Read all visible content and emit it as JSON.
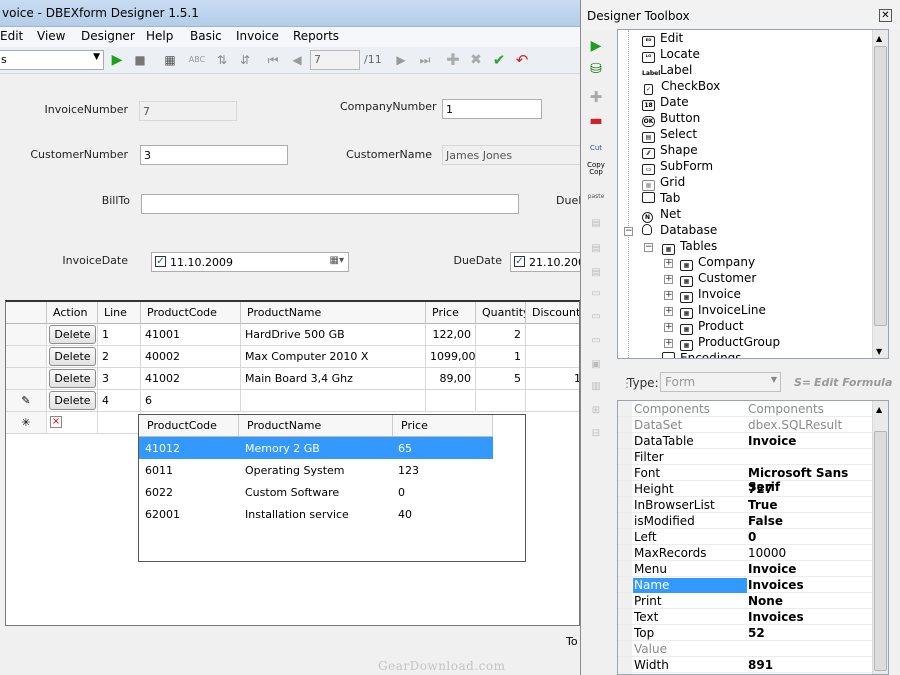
{
  "app": {
    "title": "voice - DBEXform Designer 1.5.1"
  },
  "menu": [
    "Edit",
    "View",
    "Designer",
    "Help",
    "Basic",
    "Invoice",
    "Reports"
  ],
  "toolbar": {
    "combo_value": "s",
    "record_current": "7",
    "record_total": "/11"
  },
  "form": {
    "labels": {
      "invoice_number": "InvoiceNumber",
      "company_number": "CompanyNumber",
      "customer_number": "CustomerNumber",
      "customer_name": "CustomerName",
      "bill_to": "BillTo",
      "due_partial": "DueI",
      "invoice_date": "InvoiceDate",
      "due_date": "DueDate"
    },
    "values": {
      "invoice_number": "7",
      "company_number": "1",
      "customer_number": "3",
      "customer_name": "James Jones",
      "bill_to": "",
      "invoice_date": "11.10.2009",
      "due_date": "21.10.2009"
    }
  },
  "grid": {
    "headers": [
      "Action",
      "Line",
      "ProductCode",
      "ProductName",
      "Price",
      "Quantity",
      "DiscountT"
    ],
    "delete_label": "Delete",
    "rows": [
      {
        "line": "1",
        "code": "41001",
        "name": "HardDrive 500 GB",
        "price": "122,00",
        "qty": "2",
        "disc": ""
      },
      {
        "line": "2",
        "code": "40002",
        "name": "Max Computer 2010 X",
        "price": "1099,00",
        "qty": "1",
        "disc": ""
      },
      {
        "line": "3",
        "code": "41002",
        "name": "Main Board 3,4 Ghz",
        "price": "89,00",
        "qty": "5",
        "disc": "1"
      },
      {
        "line": "4",
        "code": "6",
        "name": "",
        "price": "",
        "qty": "",
        "disc": ""
      }
    ],
    "edit_marker": "✎",
    "new_marker": "✳"
  },
  "popup": {
    "headers": [
      "ProductCode",
      "ProductName",
      "Price"
    ],
    "rows": [
      {
        "code": "41012",
        "name": "Memory 2 GB",
        "price": "65"
      },
      {
        "code": "6011",
        "name": "Operating System",
        "price": "123"
      },
      {
        "code": "6022",
        "name": "Custom Software",
        "price": "0"
      },
      {
        "code": "62001",
        "name": "Installation service",
        "price": "40"
      }
    ]
  },
  "footer_partial": "To",
  "watermark": "GearDownload.com",
  "toolbox": {
    "title": "Designer Toolbox",
    "tree": [
      "Edit",
      "Locate",
      "Label",
      "CheckBox",
      "Date",
      "Button",
      "Select",
      "Shape",
      "SubForm",
      "Grid",
      "Tab",
      "Net",
      "Database",
      "Tables",
      "Company",
      "Customer",
      "Invoice",
      "InvoiceLine",
      "Product",
      "ProductGroup",
      "Encodings"
    ],
    "type_label": "Type:",
    "type_value": "Form",
    "edit_formula": "Edit Formula",
    "properties": [
      {
        "name": "Components",
        "value": "Components"
      },
      {
        "name": "DataSet",
        "value": "dbex.SQLResult"
      },
      {
        "name": "DataTable",
        "value": "Invoice"
      },
      {
        "name": "Filter",
        "value": ""
      },
      {
        "name": "Font",
        "value": "Microsoft Sans Serif"
      },
      {
        "name": "Height",
        "value": "727"
      },
      {
        "name": "InBrowserList",
        "value": "True"
      },
      {
        "name": "isModified",
        "value": "False"
      },
      {
        "name": "Left",
        "value": "0"
      },
      {
        "name": "MaxRecords",
        "value": "10000"
      },
      {
        "name": "Menu",
        "value": "Invoice"
      },
      {
        "name": "Name",
        "value": "Invoices"
      },
      {
        "name": "Print",
        "value": "None"
      },
      {
        "name": "Text",
        "value": "Invoices"
      },
      {
        "name": "Top",
        "value": "52"
      },
      {
        "name": "Value",
        "value": ""
      },
      {
        "name": "Width",
        "value": "891"
      }
    ]
  },
  "colors": {
    "selection": "#3399ff",
    "title_gradient": "#c9dcf2"
  }
}
